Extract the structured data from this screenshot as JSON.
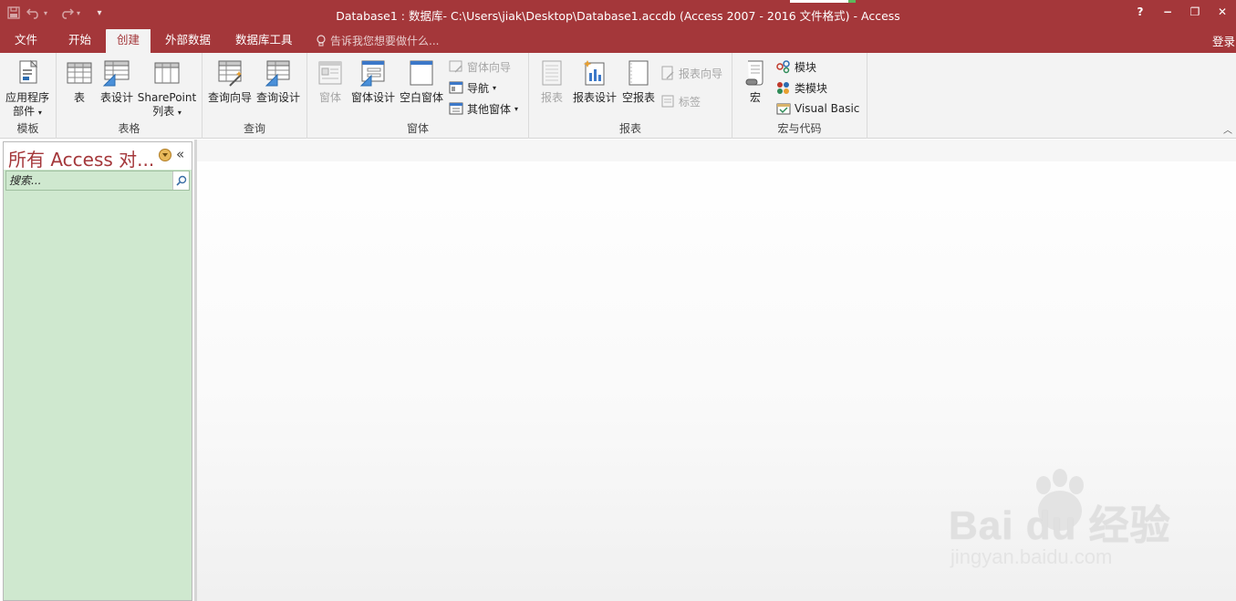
{
  "window": {
    "title": "Database1 : 数据库- C:\\Users\\jiak\\Desktop\\Database1.accdb (Access 2007 - 2016 文件格式) - Access",
    "help": "?",
    "minimize": "−",
    "restore": "❐",
    "close": "✕"
  },
  "tabs": [
    {
      "label": "文件"
    },
    {
      "label": "开始"
    },
    {
      "label": "创建"
    },
    {
      "label": "外部数据"
    },
    {
      "label": "数据库工具"
    }
  ],
  "tell_me": "告诉我您想要做什么...",
  "sign_in": "登录",
  "ribbon": {
    "templates": {
      "label": "模板",
      "app_parts_line1": "应用程序",
      "app_parts_line2": "部件"
    },
    "tables": {
      "label": "表格",
      "table": "表",
      "table_design": "表设计",
      "sharepoint_line1": "SharePoint",
      "sharepoint_line2": "列表"
    },
    "queries": {
      "label": "查询",
      "query_wizard": "查询向导",
      "query_design": "查询设计"
    },
    "forms": {
      "label": "窗体",
      "form": "窗体",
      "form_design": "窗体设计",
      "blank_form": "空白窗体",
      "form_wizard": "窗体向导",
      "navigation": "导航",
      "more_forms": "其他窗体"
    },
    "reports": {
      "label": "报表",
      "report": "报表",
      "report_design": "报表设计",
      "blank_report": "空报表",
      "report_wizard": "报表向导",
      "labels": "标签"
    },
    "macros": {
      "label": "宏与代码",
      "macro": "宏",
      "module": "模块",
      "class_module": "类模块",
      "visual_basic": "Visual Basic"
    }
  },
  "nav_pane": {
    "title": "所有 Access 对...",
    "collapse": "«",
    "search_placeholder": "搜索..."
  },
  "watermark": {
    "main": "Bai du 经验",
    "sub": "jingyan.baidu.com"
  },
  "colors": {
    "accent": "#a4373a",
    "ribbon_bg": "#f3f3f3",
    "nav_bg": "#cfe8cf"
  }
}
